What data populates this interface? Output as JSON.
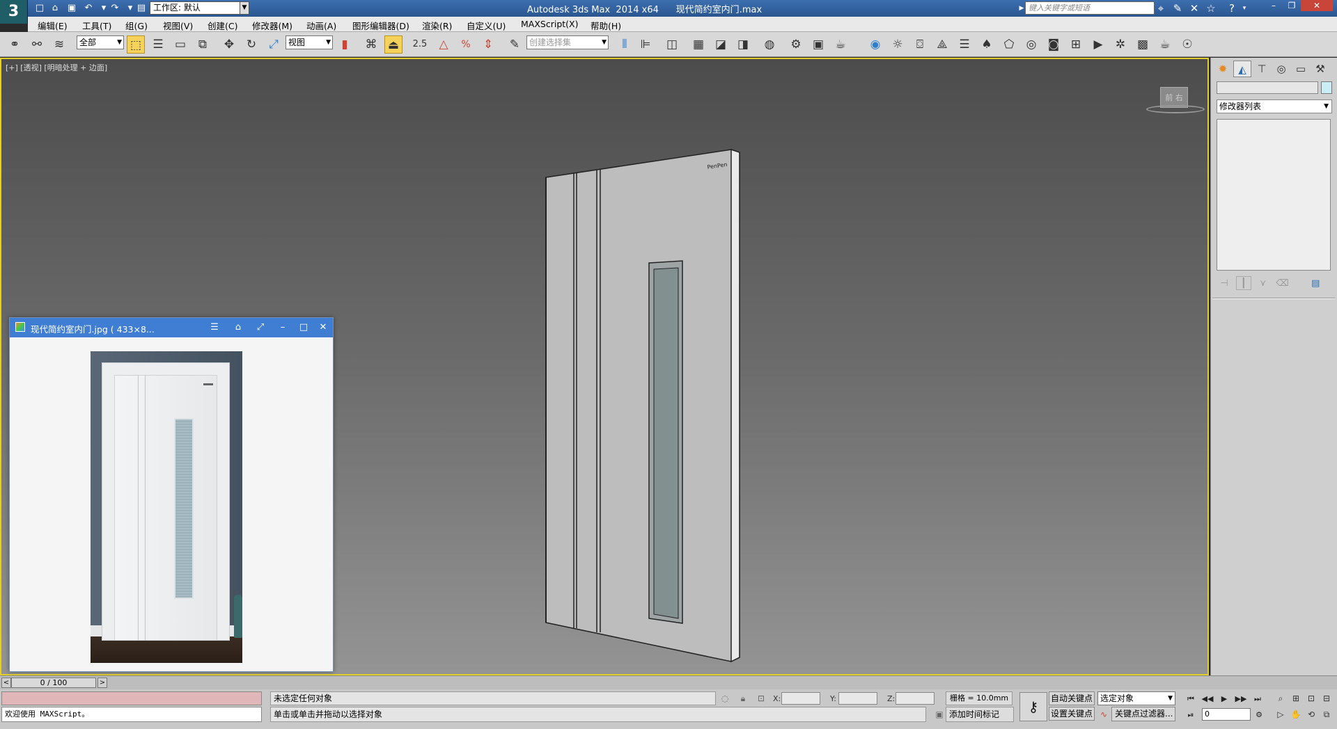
{
  "titlebar": {
    "workspace": "工作区: 默认",
    "title": "Autodesk 3ds Max  2014 x64      现代简约室内门.max",
    "keyword_placeholder": "键入关键字或短语"
  },
  "menu": [
    "编辑(E)",
    "工具(T)",
    "组(G)",
    "视图(V)",
    "创建(C)",
    "修改器(M)",
    "动画(A)",
    "图形编辑器(D)",
    "渲染(R)",
    "自定义(U)",
    "MAXScript(X)",
    "帮助(H)"
  ],
  "toolbar": {
    "filter": "全部",
    "coord_system": "视图",
    "snap_value": "2.5",
    "percent_label": "%",
    "selection_set": "创建选择集"
  },
  "viewport": {
    "label": "[+] [透视] [明暗处理 + 边面]",
    "viewcube_label": "前  右",
    "door_logo": "PenPen"
  },
  "command_panel": {
    "modifier_list": "修改器列表"
  },
  "image_viewer": {
    "title": "现代简约室内门.jpg ( 433×8..."
  },
  "timeline": {
    "frame_range": "0 / 100"
  },
  "status": {
    "maxscript_welcome": "欢迎使用 MAXScript。",
    "selection_status": "未选定任何对象",
    "prompt": "单击或单击并拖动以选择对象",
    "x_label": "X:",
    "y_label": "Y:",
    "z_label": "Z:",
    "grid": "栅格 = 10.0mm",
    "auto_key": "自动关键点",
    "set_key": "设置关键点",
    "selected_dropdown": "选定对象",
    "add_time_tag": "添加时间标记",
    "key_filters": "关键点过滤器...",
    "current_frame": "0"
  },
  "colors": {
    "title_bar": "#2a5690",
    "viewport_border": "#e3cf2b",
    "viewer_title": "#3f7ed2"
  }
}
